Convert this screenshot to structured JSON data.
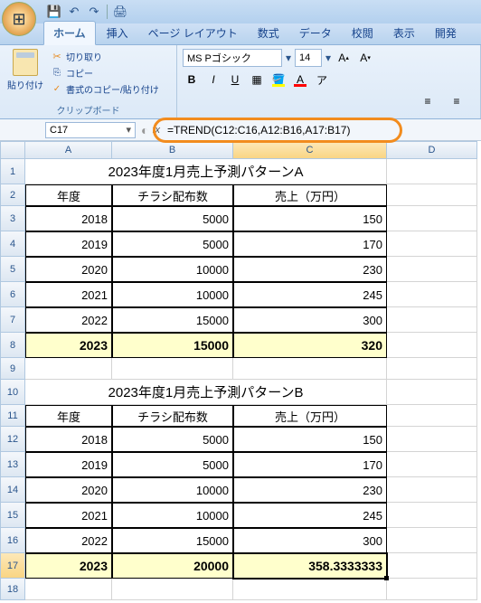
{
  "qat": {
    "save": "💾",
    "undo": "↶",
    "redo": "↷",
    "print": "🖨"
  },
  "tabs": [
    "ホーム",
    "挿入",
    "ページ レイアウト",
    "数式",
    "データ",
    "校閲",
    "表示",
    "開発"
  ],
  "clipboard": {
    "paste": "貼り付け",
    "cut": "切り取り",
    "copy": "コピー",
    "format": "書式のコピー/貼り付け",
    "group": "クリップボード"
  },
  "font": {
    "name": "MS Pゴシック",
    "size": "14"
  },
  "namebox": "C17",
  "formula": "=TREND(C12:C16,A12:B16,A17:B17)",
  "cols": [
    "A",
    "B",
    "C",
    "D"
  ],
  "tableA": {
    "title": "2023年度1月売上予測パターンA",
    "headers": [
      "年度",
      "チラシ配布数",
      "売上（万円）"
    ],
    "rows": [
      [
        "2018",
        "5000",
        "150"
      ],
      [
        "2019",
        "5000",
        "170"
      ],
      [
        "2020",
        "10000",
        "230"
      ],
      [
        "2021",
        "10000",
        "245"
      ],
      [
        "2022",
        "15000",
        "300"
      ],
      [
        "2023",
        "15000",
        "320"
      ]
    ]
  },
  "tableB": {
    "title": "2023年度1月売上予測パターンB",
    "headers": [
      "年度",
      "チラシ配布数",
      "売上（万円）"
    ],
    "rows": [
      [
        "2018",
        "5000",
        "150"
      ],
      [
        "2019",
        "5000",
        "170"
      ],
      [
        "2020",
        "10000",
        "230"
      ],
      [
        "2021",
        "10000",
        "245"
      ],
      [
        "2022",
        "15000",
        "300"
      ],
      [
        "2023",
        "20000",
        "358.3333333"
      ]
    ]
  }
}
